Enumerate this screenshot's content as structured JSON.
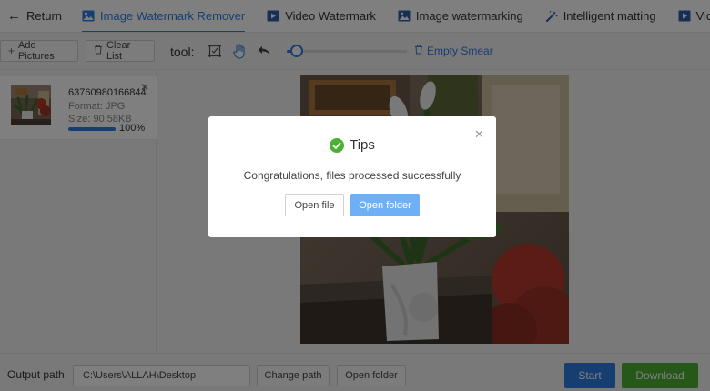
{
  "nav": {
    "return_label": "Return",
    "tabs": [
      {
        "label": "Image Watermark Remover",
        "icon": "image-icon",
        "active": true
      },
      {
        "label": "Video Watermark",
        "icon": "video-icon",
        "active": false
      },
      {
        "label": "Image watermarking",
        "icon": "image-add-icon",
        "active": false
      },
      {
        "label": "Intelligent matting",
        "icon": "magic-wand-icon",
        "active": false
      },
      {
        "label": "Video",
        "icon": "video-icon",
        "active": false
      }
    ]
  },
  "toolbar": {
    "add_pictures": "Add Pictures",
    "clear_list": "Clear List",
    "tool_label": "tool:",
    "empty_smear": "Empty Smear",
    "brush_size_fraction": 0.08
  },
  "files": [
    {
      "name": "63760980166844...",
      "format": "Format:  JPG",
      "size": "Size:  90.58KB",
      "progress_percent": "100%",
      "progress_fraction": 1.0
    }
  ],
  "bottom": {
    "output_label": "Output path:",
    "output_path": "C:\\Users\\ALLAH\\Desktop",
    "change_path": "Change path",
    "open_folder": "Open folder",
    "start": "Start",
    "download": "Download"
  },
  "modal": {
    "title": "Tips",
    "message": "Congratulations, files processed successfully",
    "open_file": "Open file",
    "open_folder": "Open folder"
  },
  "colors": {
    "accent": "#2f7de1",
    "success": "#4cb034",
    "modal_primary": "#6db0f6"
  }
}
